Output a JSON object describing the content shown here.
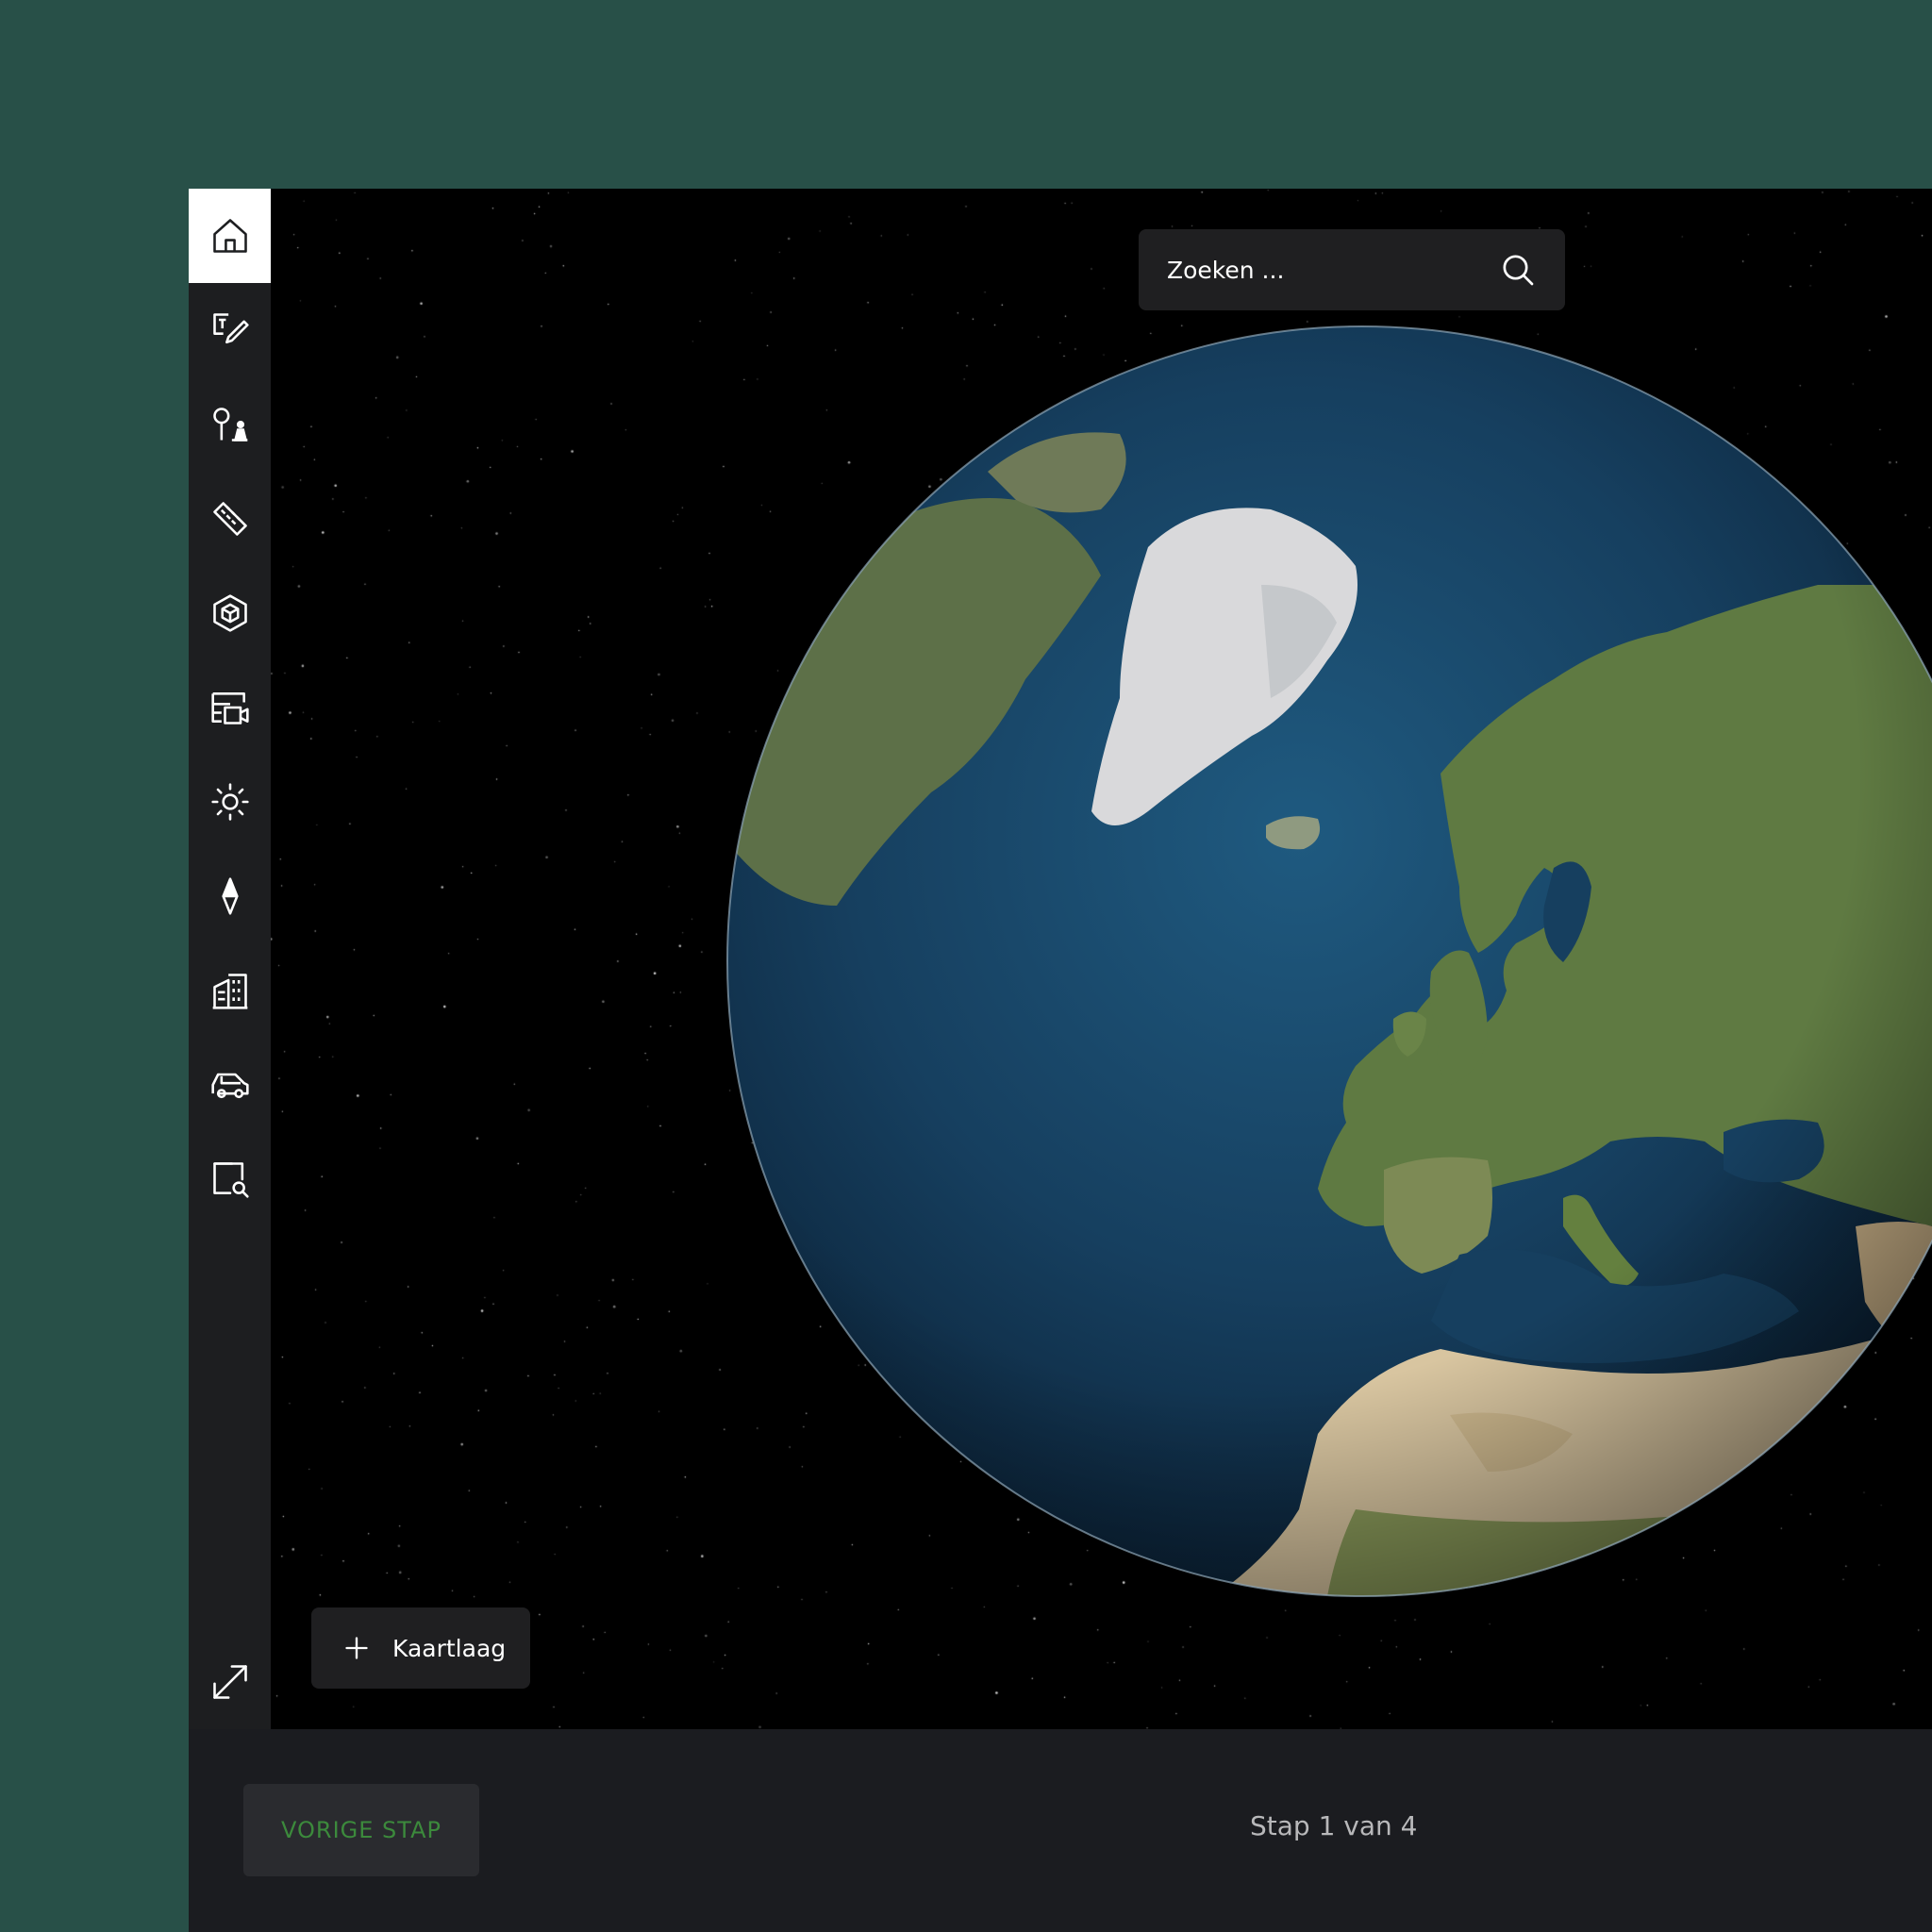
{
  "search": {
    "placeholder": "Zoeken ..."
  },
  "layer_button": {
    "label": "Kaartlaag"
  },
  "footer": {
    "prev_label": "VORIGE STAP",
    "step_label": "Stap 1 van 4"
  },
  "sidebar": {
    "items": [
      {
        "icon": "home-icon",
        "active": true
      },
      {
        "icon": "text-edit-icon"
      },
      {
        "icon": "pin-person-icon"
      },
      {
        "icon": "ruler-icon"
      },
      {
        "icon": "cube-icon"
      },
      {
        "icon": "presentation-icon"
      },
      {
        "icon": "sun-icon"
      },
      {
        "icon": "compass-icon"
      },
      {
        "icon": "building-icon"
      },
      {
        "icon": "car-icon"
      },
      {
        "icon": "search-area-icon"
      },
      {
        "icon": "fullscreen-icon"
      }
    ]
  },
  "colors": {
    "background": "#285048",
    "sidebar": "#1d1e20",
    "footer": "#1b1c20",
    "accent_green": "#3c8a3c"
  }
}
